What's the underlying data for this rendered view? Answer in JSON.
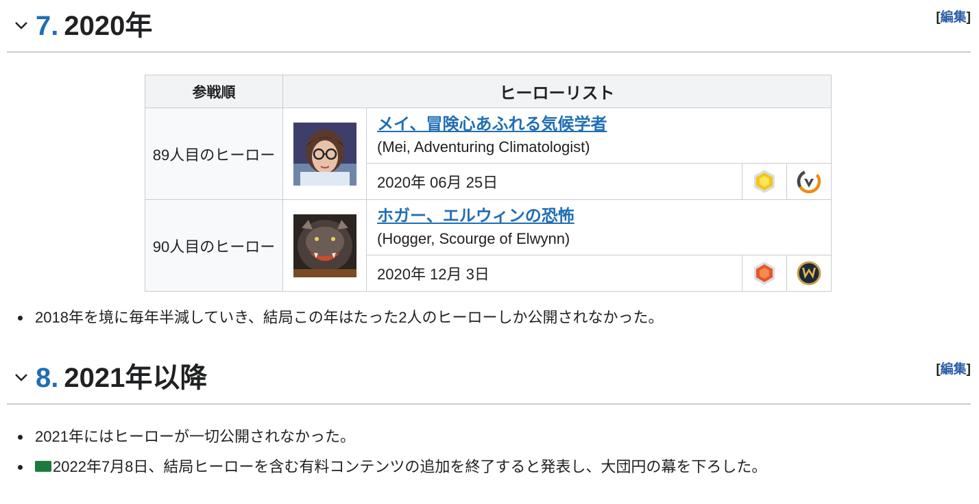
{
  "section7": {
    "number": "7.",
    "title": "2020年",
    "edit_open": "[",
    "edit_label": "編集",
    "edit_close": "]"
  },
  "table": {
    "header_order": "参戦順",
    "header_list": "ヒーローリスト",
    "rows": [
      {
        "order": "89人目のヒーロー",
        "name": "メイ、冒険心あふれる気候学者",
        "english": "(Mei, Adventuring Climatologist)",
        "date": "2020年 06月 25日",
        "rarity_icon": "legendary-gold-gem-icon",
        "franchise_icon": "overwatch-logo-icon"
      },
      {
        "order": "90人目のヒーロー",
        "name": "ホガー、エルウィンの恐怖",
        "english": "(Hogger, Scourge of Elwynn)",
        "date": "2020年 12月 3日",
        "rarity_icon": "epic-orange-gem-icon",
        "franchise_icon": "warcraft-logo-icon"
      }
    ]
  },
  "notes7": [
    "2018年を境に毎年半減していき、結局この年はたった2人のヒーローしか公開されなかった。"
  ],
  "section8": {
    "number": "8.",
    "title": "2021年以降",
    "edit_open": "[",
    "edit_label": "編集",
    "edit_close": "]"
  },
  "notes8": [
    "2021年にはヒーローが一切公開されなかった。",
    "2022年7月8日、結局ヒーローを含む有料コンテンツの追加を終了すると発表し、大団円の幕を下ろした。"
  ],
  "colors": {
    "link": "#1f6eb4",
    "heading_number": "#1f6eb4",
    "border": "#c8ccd1",
    "header_bg": "#f2f3f5"
  }
}
